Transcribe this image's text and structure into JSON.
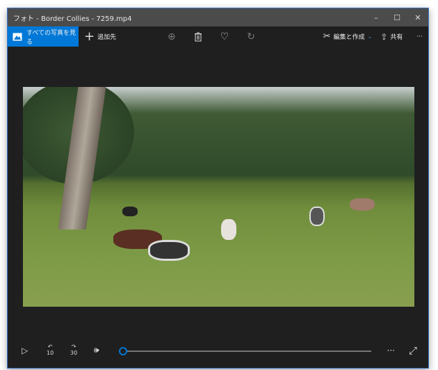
{
  "window": {
    "title": "フォト - Border Collies - 7259.mp4",
    "minimize": "–",
    "maximize": "☐",
    "close": "✕"
  },
  "toolbar": {
    "all_photos": "すべての写真を見る",
    "add_to": "追加先",
    "edit_create": "編集と作成",
    "share": "共有",
    "more": "···",
    "icons": [
      "zoom-in-icon",
      "delete-icon",
      "heart-icon",
      "rotate-icon"
    ]
  },
  "player": {
    "skip_back": "10",
    "skip_forward": "30",
    "more": "···",
    "progress": 0,
    "accent": "#0078d7"
  }
}
